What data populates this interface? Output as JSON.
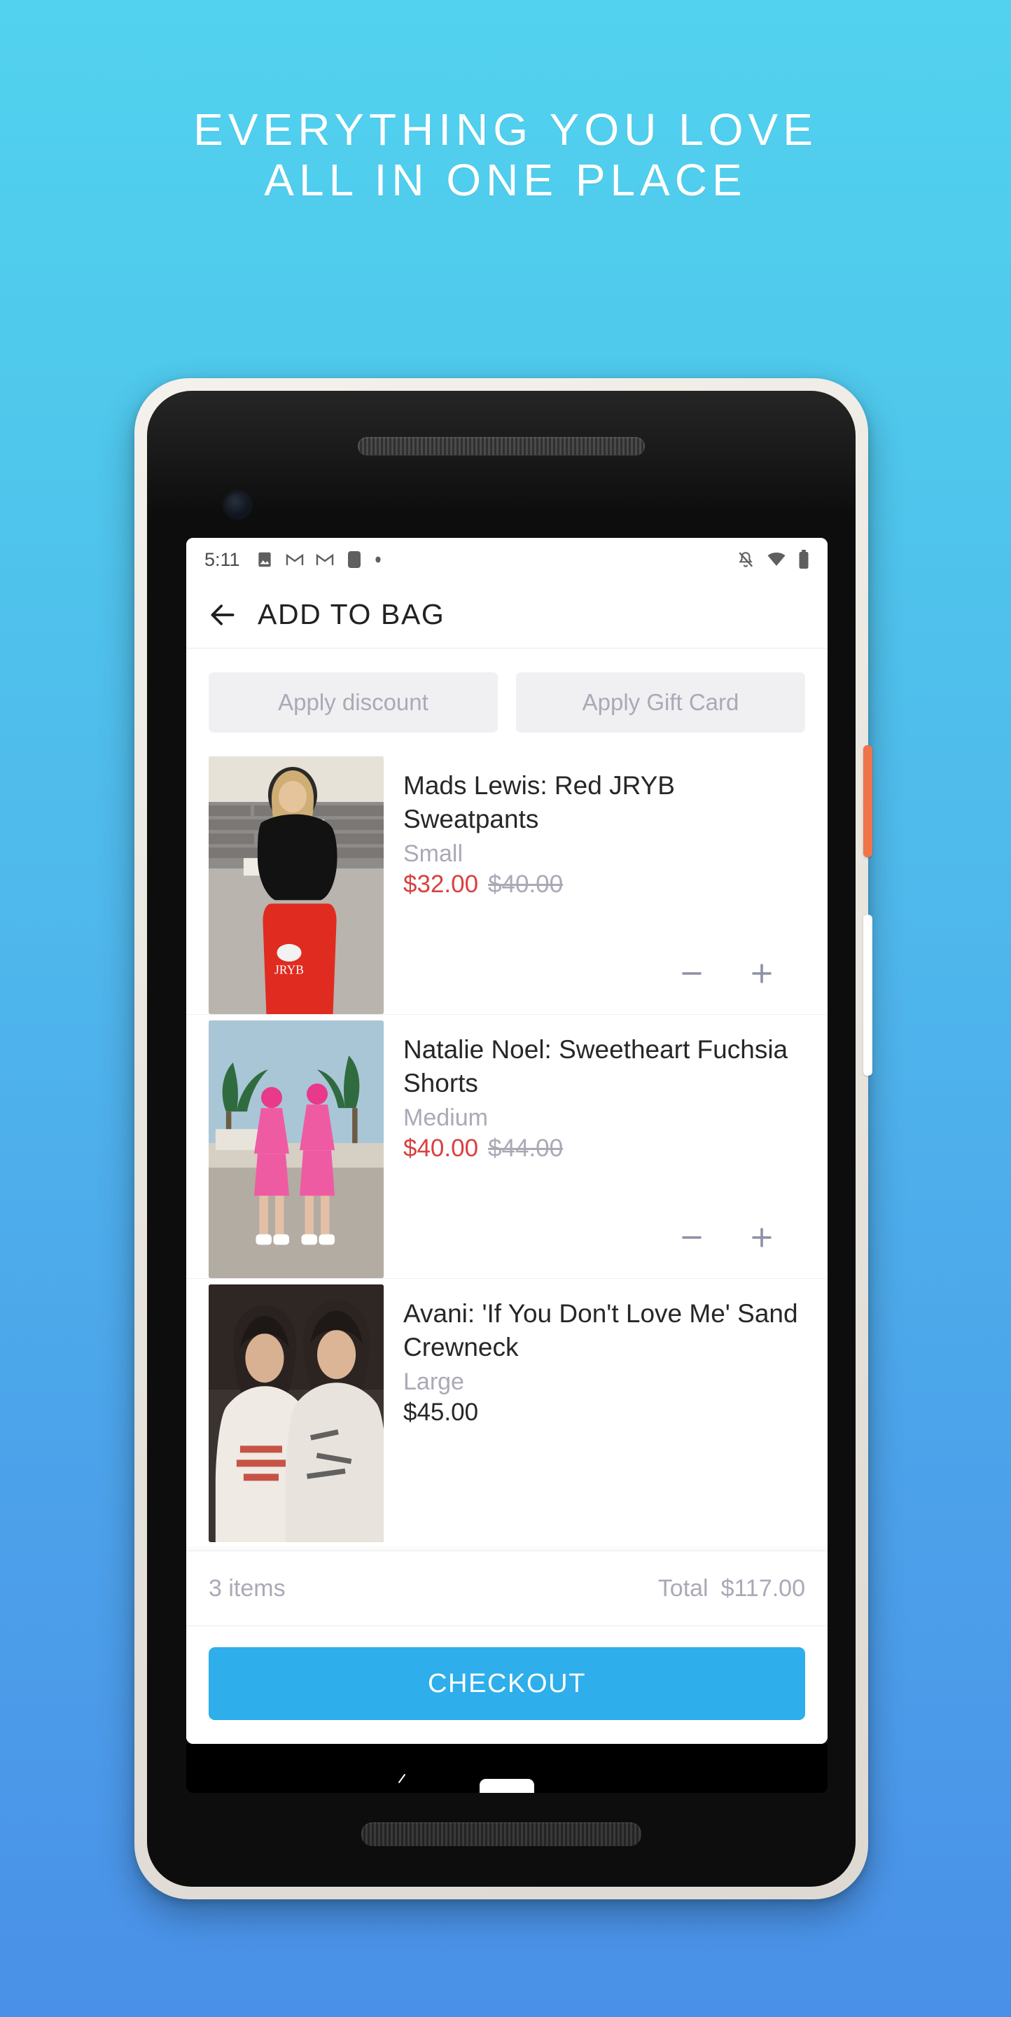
{
  "hero": {
    "line1": "EVERYTHING YOU LOVE",
    "line2": "ALL IN ONE PLACE",
    "background_top": "#52d2ef",
    "background_bottom": "#4a90e8",
    "text_color": "#ffffff"
  },
  "device": {
    "frame_color": "#ece8e2",
    "power_button_color": "#f0744a",
    "volume_button_color": "#ffffff"
  },
  "status_bar": {
    "time": "5:11",
    "left_icons": [
      "photo-icon",
      "gmail-icon",
      "gmail-icon",
      "app-square-icon",
      "dot-icon"
    ],
    "right_icons": [
      "notifications-off-icon",
      "wifi-icon",
      "battery-icon"
    ]
  },
  "app_bar": {
    "back_icon": "arrow-left-icon",
    "title": "ADD TO BAG"
  },
  "promos": [
    {
      "label": "Apply discount",
      "name": "apply-discount-button"
    },
    {
      "label": "Apply Gift Card",
      "name": "apply-gift-card-button"
    }
  ],
  "cart": {
    "items": [
      {
        "title": "Mads Lewis: Red JRYB Sweatpants",
        "size": "Small",
        "price": "$32.00",
        "was_price": "$40.00",
        "thumb_alt": "blonde-model-black-sweater-red-sweatpants"
      },
      {
        "title": "Natalie Noel: Sweetheart Fuchsia Shorts",
        "size": "Medium",
        "price": "$40.00",
        "was_price": "$44.00",
        "thumb_alt": "two-models-pink-tracksuits-palm-trees"
      },
      {
        "title": "Avani: 'If You Don't Love Me' Sand Crewneck",
        "size": "Large",
        "price": "$45.00",
        "was_price": "",
        "thumb_alt": "two-models-printed-crewnecks"
      }
    ],
    "decrease_icon": "minus-icon",
    "increase_icon": "plus-icon"
  },
  "totals": {
    "items_count": "3 items",
    "total_label": "Total",
    "total_value": "$117.00"
  },
  "checkout": {
    "label": "CHECKOUT",
    "color": "#2eaeeb"
  },
  "colors": {
    "sale_price": "#d94040",
    "muted_text": "#a9aab6",
    "primary_text": "#272727",
    "promo_bg": "#f0f0f2"
  }
}
